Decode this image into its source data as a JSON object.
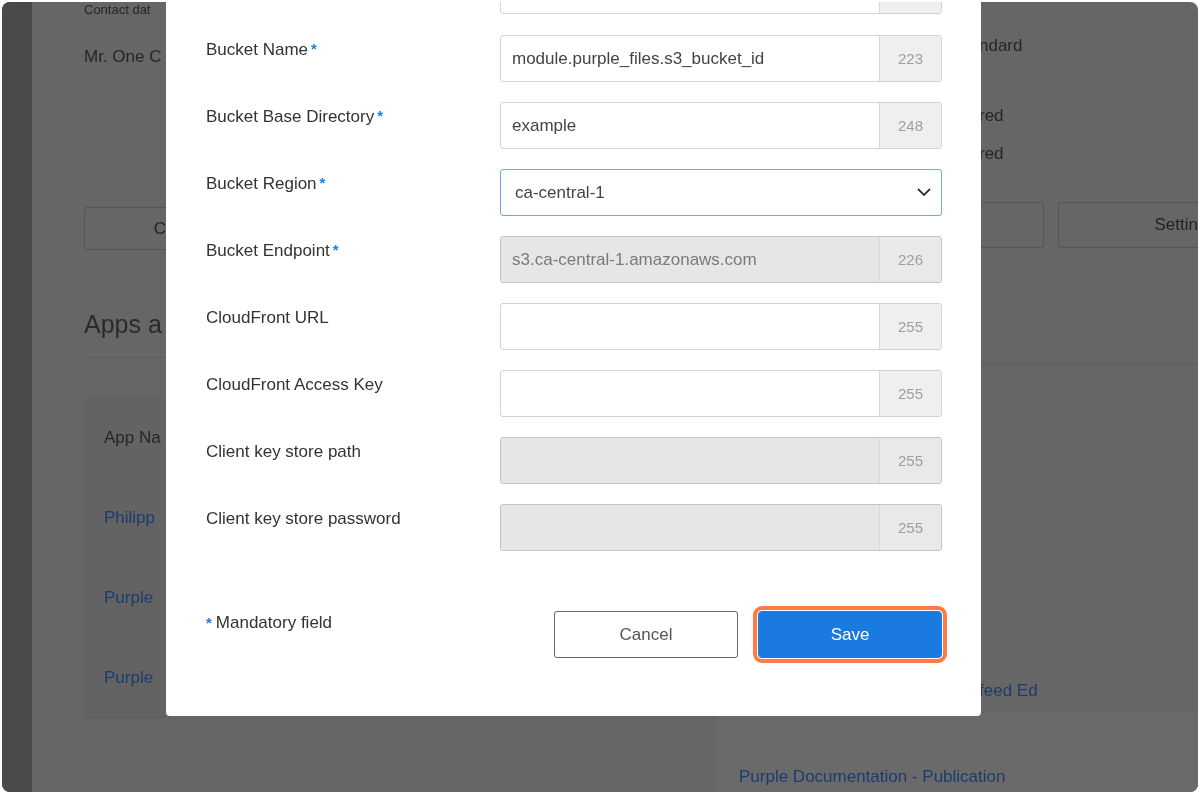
{
  "background_page": {
    "left": {
      "contact_heading": "Contact dat",
      "contact_name": "Mr. One C",
      "button_label": "C",
      "section_title": "Apps a",
      "table_header": "App Na",
      "rows": [
        "Philipp",
        "Purple",
        "Purple"
      ]
    },
    "right": {
      "texts": [
        "ndard",
        "red",
        "red"
      ],
      "settings_button": "Settin",
      "row_link": "feed Ed"
    },
    "bottom_link": "Purple Documentation - Publication"
  },
  "dialog": {
    "fields": [
      {
        "label": "Bucket Name",
        "required": true,
        "kind": "text",
        "value": "module.purple_files.s3_bucket_id",
        "counter": "223",
        "disabled": false
      },
      {
        "label": "Bucket Base Directory",
        "required": true,
        "kind": "text",
        "value": "example",
        "counter": "248",
        "disabled": false
      },
      {
        "label": "Bucket Region",
        "required": true,
        "kind": "select",
        "value": "ca-central-1",
        "disabled": false
      },
      {
        "label": "Bucket Endpoint",
        "required": true,
        "kind": "text",
        "value": "s3.ca-central-1.amazonaws.com",
        "counter": "226",
        "disabled": true
      },
      {
        "label": "CloudFront URL",
        "required": false,
        "kind": "text",
        "counter": "255",
        "disabled": false
      },
      {
        "label": "CloudFront Access Key",
        "required": false,
        "kind": "text",
        "counter": "255",
        "disabled": false
      },
      {
        "label": "Client key store path",
        "required": false,
        "kind": "text",
        "counter": "255",
        "disabled": true
      },
      {
        "label": "Client key store password",
        "required": false,
        "kind": "text",
        "counter": "255",
        "disabled": true
      }
    ],
    "required_marker": "*",
    "note": "Mandatory field",
    "buttons": [
      {
        "label": "Cancel",
        "kind": "secondary",
        "highlighted": false
      },
      {
        "label": "Save",
        "kind": "primary",
        "highlighted": true
      }
    ]
  }
}
